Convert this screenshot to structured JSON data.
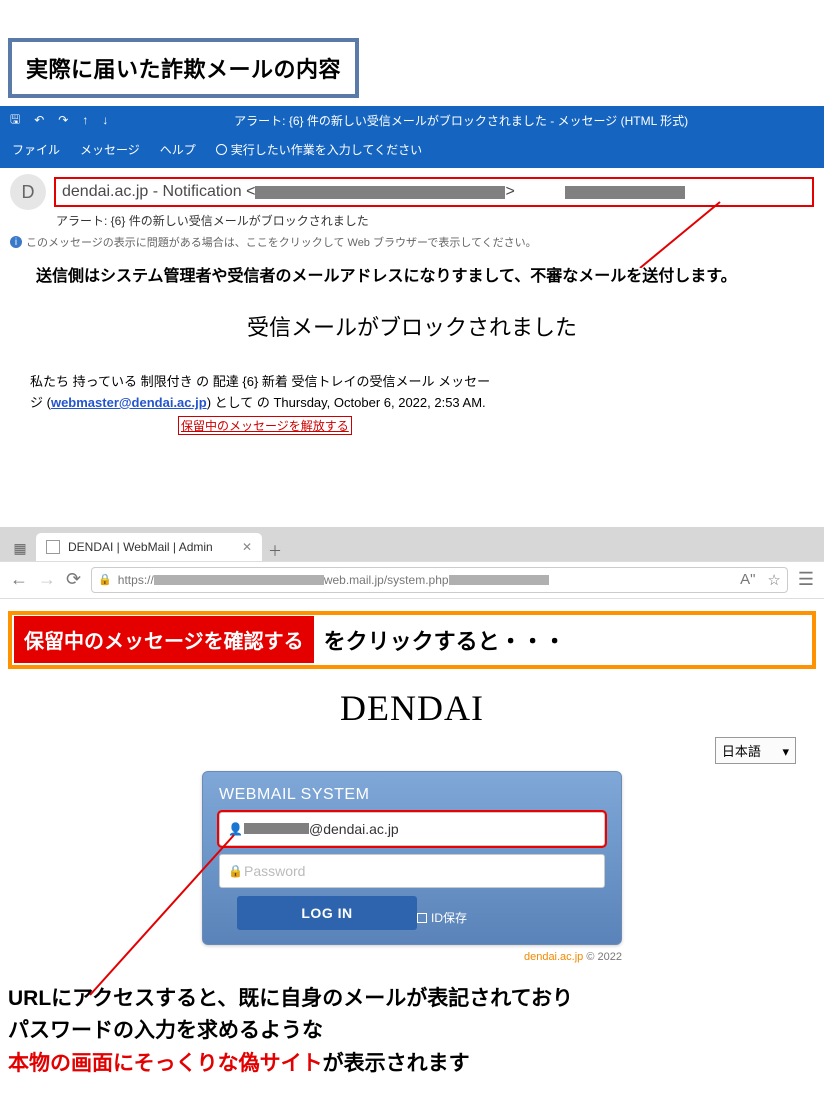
{
  "heading": "実際に届いた詐欺メールの内容",
  "outlook": {
    "title": "アラート: {6} 件の新しい受信メールがブロックされました  -  メッセージ (HTML 形式)",
    "menu": {
      "file": "ファイル",
      "message": "メッセージ",
      "help": "ヘルプ"
    },
    "search_hint": "実行したい作業を入力してください",
    "avatar_initial": "D",
    "sender_text": "dendai.ac.jp - Notification <",
    "sender_gt": ">",
    "subject": "アラート: {6} 件の新しい受信メールがブロックされました",
    "info_bar": "このメッセージの表示に問題がある場合は、ここをクリックして Web ブラウザーで表示してください。"
  },
  "annotation1": "送信側はシステム管理者や受信者のメールアドレスになりすまして、不審なメールを送付します。",
  "mail_body": {
    "title": "受信メールがブロックされました",
    "line1": "私たち 持っている 制限付き の 配達 {6} 新着 受信トレイの受信メール メッセー",
    "line2_prefix": "ジ (",
    "line2_link": "webmaster@dendai.ac.jp",
    "line2_suffix": ") として の Thursday, October 6, 2022, 2:53 AM.",
    "release": "保留中のメッセージを解放する"
  },
  "browser": {
    "tab_title": "DENDAI | WebMail | Admin",
    "proto": "https://",
    "url_mid": "web.mail.jp/system.php",
    "reader_label": "A\""
  },
  "callout": {
    "button": "保留中のメッセージを確認する",
    "text": "をクリックすると・・・"
  },
  "fake_login": {
    "brand": "DENDAI",
    "lang": "日本語",
    "panel_title": "WEBMAIL SYSTEM",
    "email_domain": "@dendai.ac.jp",
    "password_placeholder": "Password",
    "login_label": "LOG IN",
    "save_id": "ID保存",
    "copyright_brand": "dendai.ac.jp",
    "copyright_rest": " © 2022"
  },
  "final": {
    "l1": "URLにアクセスすると、既に自身のメールが表記されており",
    "l2": "パスワードの入力を求めるような",
    "l3_red": "本物の画面にそっくりな偽サイト",
    "l3_rest": "が表示されます"
  }
}
